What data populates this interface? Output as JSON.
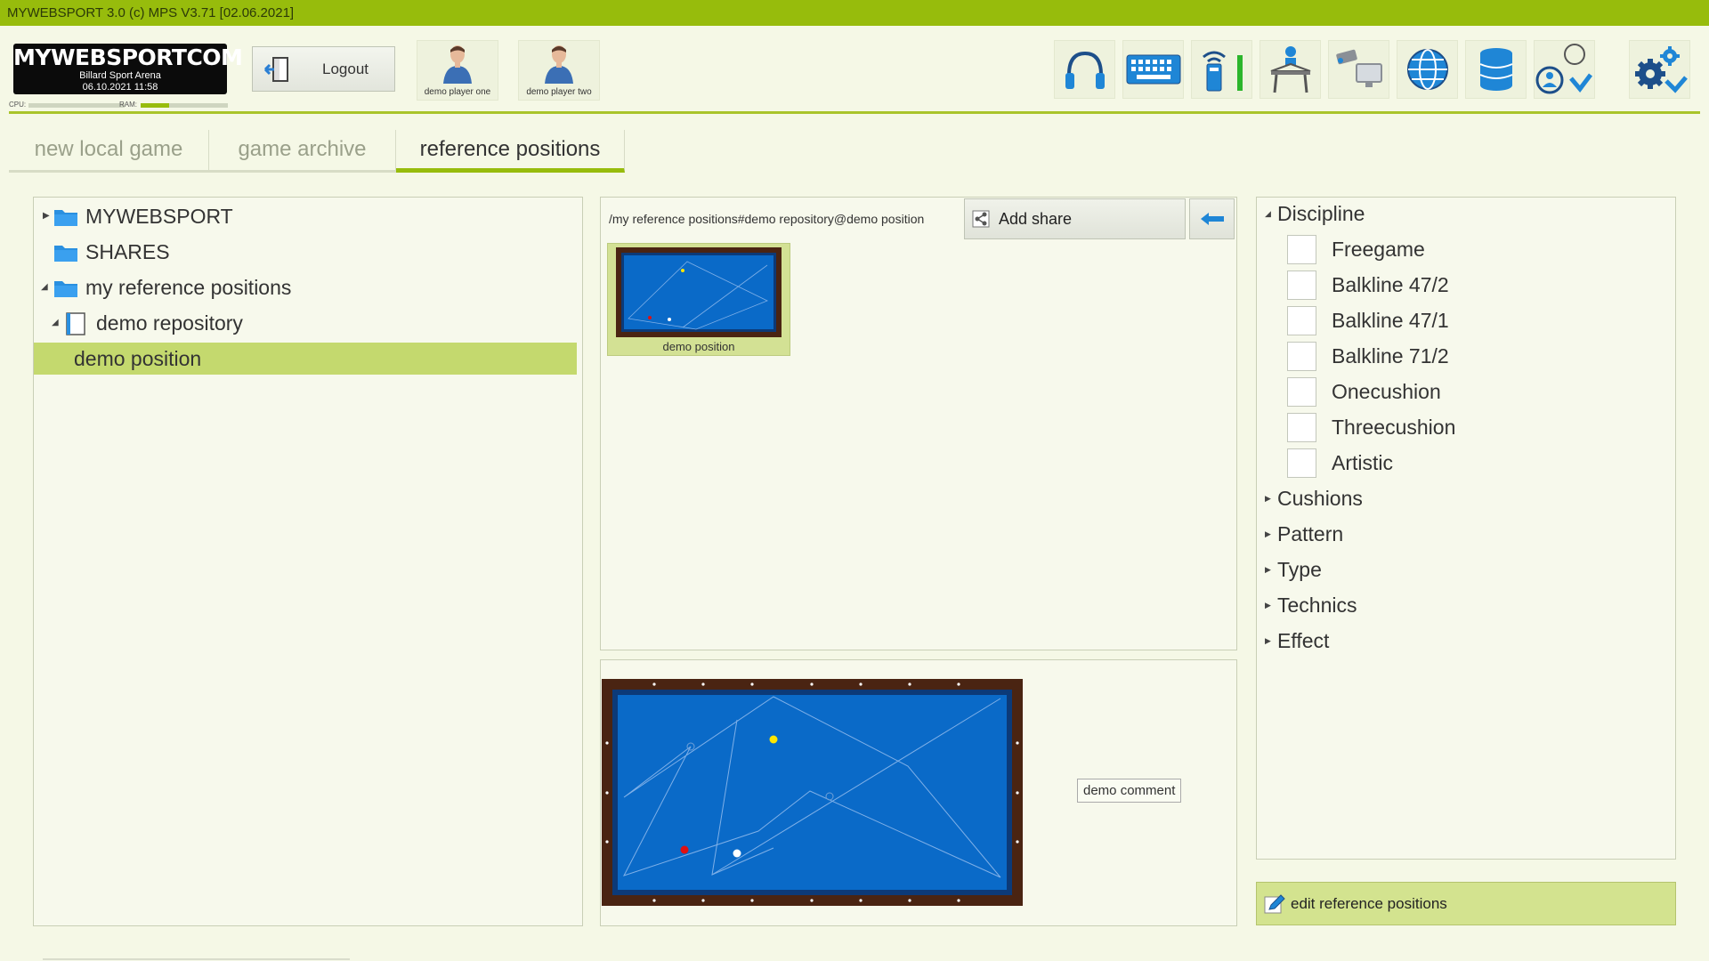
{
  "titlebar": {
    "text": "MYWEBSPORT 3.0  (c) MPS V3.71 [02.06.2021]"
  },
  "logo": {
    "brand": "MYWEBSPORTCOM",
    "venue": "Billard Sport Arena",
    "datetime": "06.10.2021  11:58"
  },
  "meters": {
    "cpu_label": "CPU:",
    "ram_label": "RAM:",
    "cpu_level": 0.0,
    "ram_level": 0.33
  },
  "header": {
    "logout_label": "Logout",
    "players": [
      {
        "name": "demo player one"
      },
      {
        "name": "demo player two"
      }
    ],
    "tools": [
      "headphones-icon",
      "keyboard-icon",
      "remote-signal-icon",
      "presenter-icon",
      "camera-monitor-icon",
      "globe-icon",
      "database-icon",
      "user-switch-icon",
      "settings-icon"
    ]
  },
  "tabs": [
    {
      "label": "new local game",
      "active": false
    },
    {
      "label": "game archive",
      "active": false
    },
    {
      "label": "reference positions",
      "active": true
    }
  ],
  "tree": {
    "items": [
      {
        "label": "MYWEBSPORT",
        "expanded": false
      },
      {
        "label": "SHARES"
      },
      {
        "label": "my reference positions",
        "expanded": true
      },
      {
        "label": "demo repository",
        "expanded": true
      },
      {
        "label": "demo position",
        "selected": true
      }
    ]
  },
  "positions": {
    "path": "/my reference positions#demo repository@demo position",
    "add_share_label": "Add share",
    "thumbnails": [
      {
        "label": "demo position"
      }
    ]
  },
  "preview": {
    "comment": "demo comment"
  },
  "filters": {
    "discipline": {
      "label": "Discipline",
      "expanded": true,
      "options": [
        "Freegame",
        "Balkline 47/2",
        "Balkline 47/1",
        "Balkline 71/2",
        "Onecushion",
        "Threecushion",
        "Artistic"
      ]
    },
    "groups": [
      "Cushions",
      "Pattern",
      "Type",
      "Technics",
      "Effect"
    ]
  },
  "edit_label": "edit reference positions",
  "colors": {
    "accent": "#97bc0c",
    "selected": "#c4d96e",
    "table_cloth": "#0a6ac8",
    "table_frame": "#4a2412"
  }
}
